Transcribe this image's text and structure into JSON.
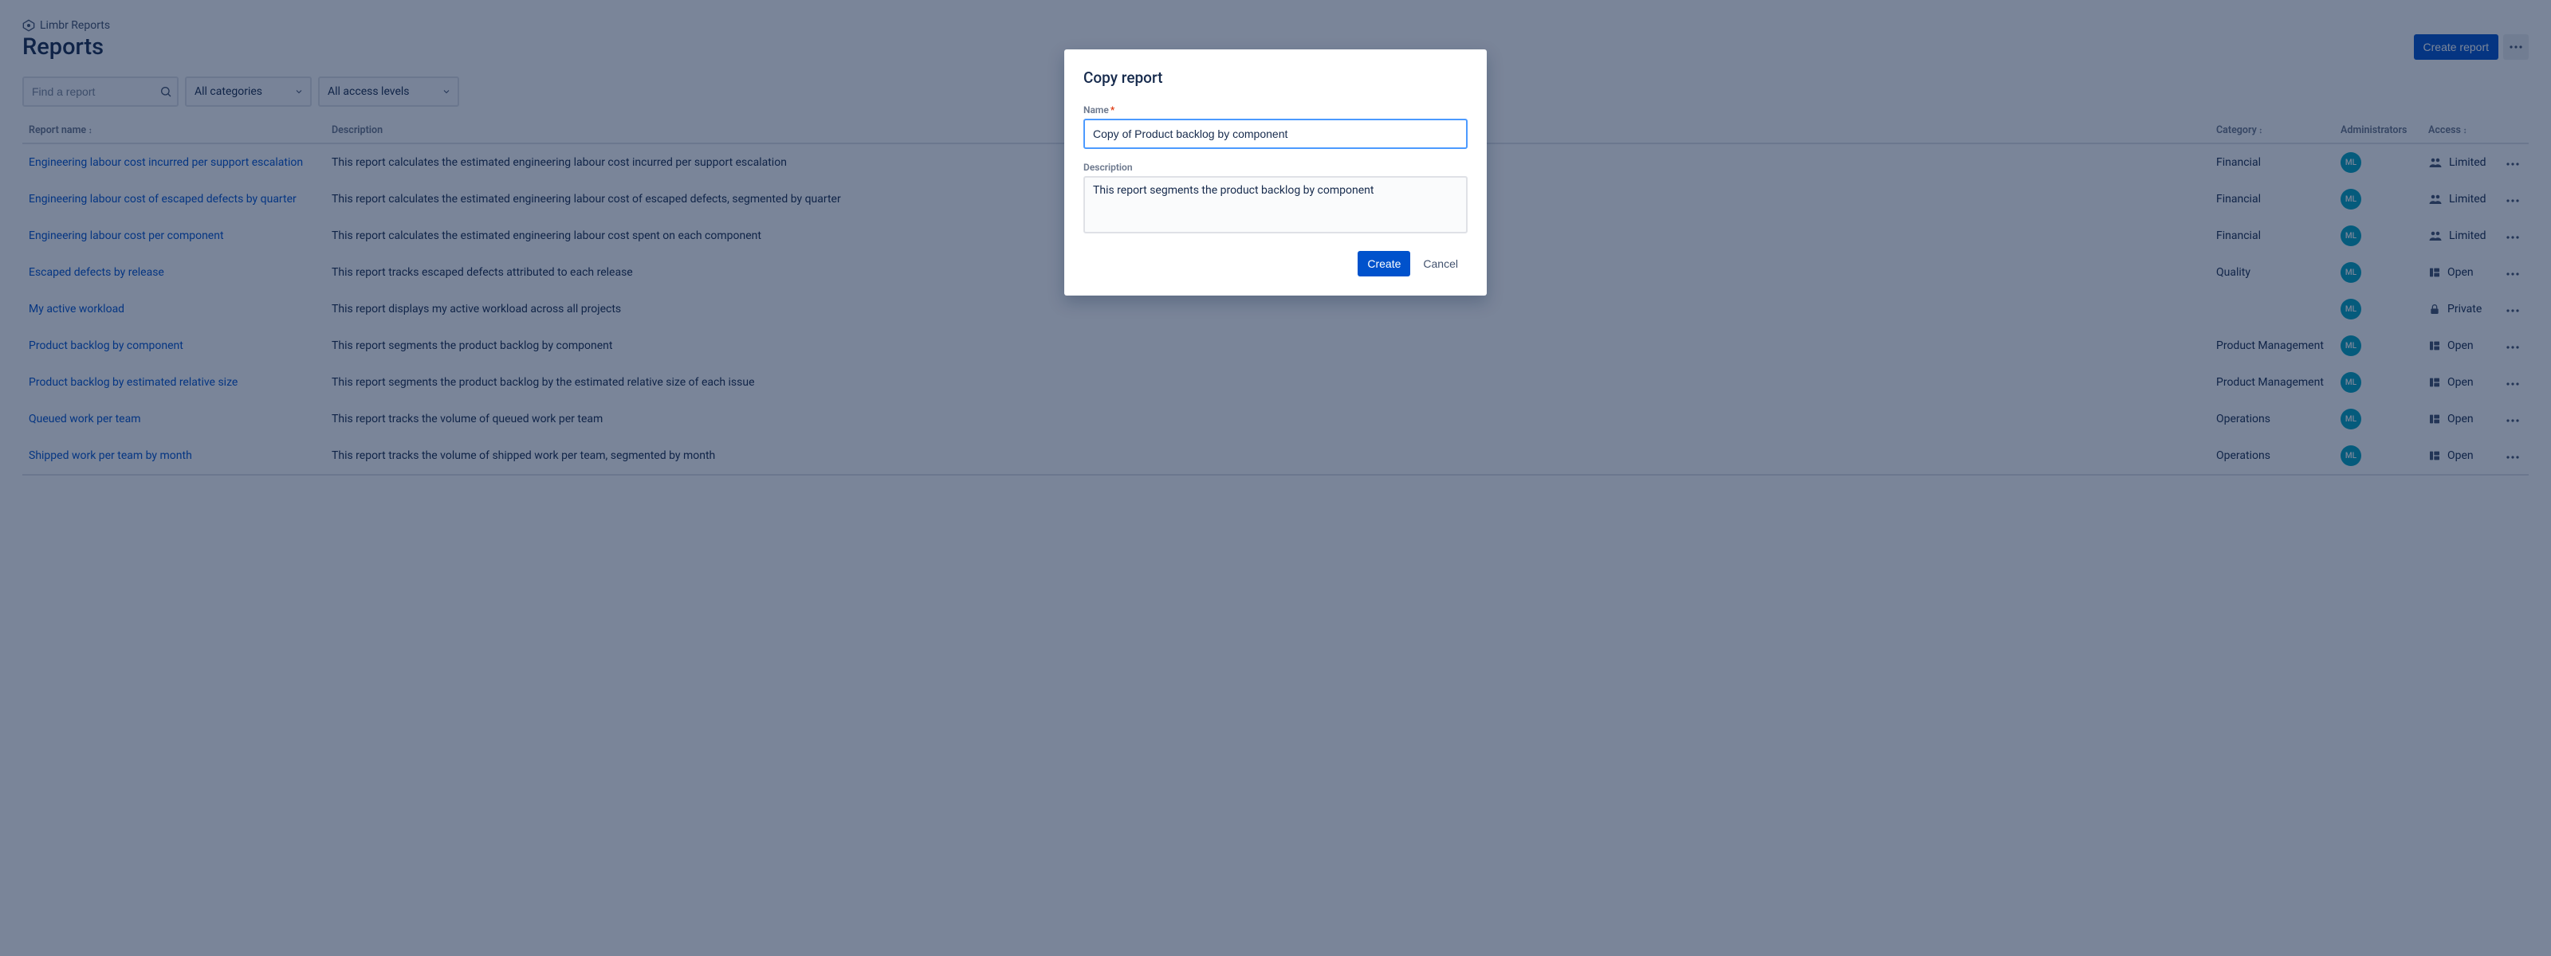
{
  "breadcrumb": {
    "label": "Limbr Reports"
  },
  "page": {
    "title": "Reports"
  },
  "header": {
    "create_label": "Create report"
  },
  "filters": {
    "search_placeholder": "Find a report",
    "category_label": "All categories",
    "access_label": "All access levels"
  },
  "columns": {
    "name": "Report name",
    "description": "Description",
    "category": "Category",
    "administrators": "Administrators",
    "access": "Access"
  },
  "admin_initials": "ML",
  "rows": [
    {
      "name": "Engineering labour cost incurred per support escalation",
      "description": "This report calculates the estimated engineering labour cost incurred per support escalation",
      "category": "Financial",
      "access": {
        "type": "limited",
        "label": "Limited"
      }
    },
    {
      "name": "Engineering labour cost of escaped defects by quarter",
      "description": "This report calculates the estimated engineering labour cost of escaped defects, segmented by quarter",
      "category": "Financial",
      "access": {
        "type": "limited",
        "label": "Limited"
      }
    },
    {
      "name": "Engineering labour cost per component",
      "description": "This report calculates the estimated engineering labour cost spent on each component",
      "category": "Financial",
      "access": {
        "type": "limited",
        "label": "Limited"
      }
    },
    {
      "name": "Escaped defects by release",
      "description": "This report tracks escaped defects attributed to each release",
      "category": "Quality",
      "access": {
        "type": "open",
        "label": "Open"
      }
    },
    {
      "name": "My active workload",
      "description": "This report displays my active workload across all projects",
      "category": "",
      "access": {
        "type": "private",
        "label": "Private"
      }
    },
    {
      "name": "Product backlog by component",
      "description": "This report segments the product backlog by component",
      "category": "Product Management",
      "access": {
        "type": "open",
        "label": "Open"
      }
    },
    {
      "name": "Product backlog by estimated relative size",
      "description": "This report segments the product backlog by the estimated relative size of each issue",
      "category": "Product Management",
      "access": {
        "type": "open",
        "label": "Open"
      }
    },
    {
      "name": "Queued work per team",
      "description": "This report tracks the volume of queued work per team",
      "category": "Operations",
      "access": {
        "type": "open",
        "label": "Open"
      }
    },
    {
      "name": "Shipped work per team by month",
      "description": "This report tracks the volume of shipped work per team, segmented by month",
      "category": "Operations",
      "access": {
        "type": "open",
        "label": "Open"
      }
    }
  ],
  "modal": {
    "title": "Copy report",
    "name_label": "Name",
    "name_value": "Copy of Product backlog by component",
    "description_label": "Description",
    "description_value": "This report segments the product backlog by component",
    "create_label": "Create",
    "cancel_label": "Cancel"
  }
}
